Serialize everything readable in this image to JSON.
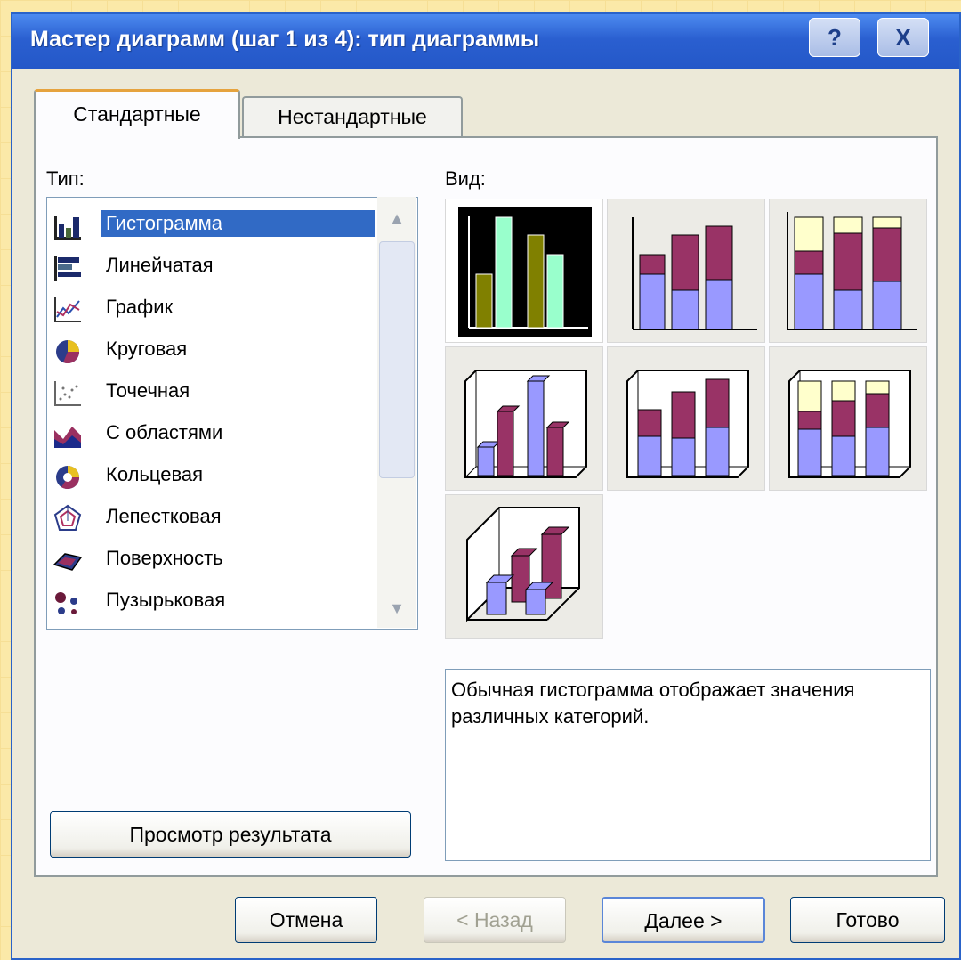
{
  "window": {
    "title": "Мастер диаграмм (шаг 1 из 4): тип диаграммы",
    "help_label": "?",
    "close_label": "X"
  },
  "tabs": [
    {
      "label": "Стандартные",
      "active": true
    },
    {
      "label": "Нестандартные",
      "active": false
    }
  ],
  "type_label": "Тип:",
  "view_label": "Вид:",
  "chart_types": [
    {
      "label": "Гистограмма",
      "icon": "column-chart-icon",
      "selected": true
    },
    {
      "label": "Линейчатая",
      "icon": "bar-chart-icon"
    },
    {
      "label": "График",
      "icon": "line-chart-icon"
    },
    {
      "label": "Круговая",
      "icon": "pie-chart-icon"
    },
    {
      "label": "Точечная",
      "icon": "scatter-chart-icon"
    },
    {
      "label": "С областями",
      "icon": "area-chart-icon"
    },
    {
      "label": "Кольцевая",
      "icon": "doughnut-chart-icon"
    },
    {
      "label": "Лепестковая",
      "icon": "radar-chart-icon"
    },
    {
      "label": "Поверхность",
      "icon": "surface-chart-icon"
    },
    {
      "label": "Пузырьковая",
      "icon": "bubble-chart-icon"
    }
  ],
  "subtypes": [
    {
      "name": "clustered-column",
      "selected": true
    },
    {
      "name": "stacked-column"
    },
    {
      "name": "100-stacked-column"
    },
    {
      "name": "3d-clustered-column"
    },
    {
      "name": "3d-stacked-column"
    },
    {
      "name": "3d-100-stacked-column"
    },
    {
      "name": "3d-column"
    }
  ],
  "description": "Обычная гистограмма отображает значения различных категорий.",
  "buttons": {
    "preview": "Просмотр результата",
    "cancel": "Отмена",
    "back": "< Назад",
    "next": "Далее >",
    "finish": "Готово"
  },
  "colors": {
    "titlebar": "#2458c8",
    "selection": "#316ac5",
    "series_blue": "#9999ff",
    "series_purple": "#993366",
    "series_yellow": "#ffffcc",
    "series_olive": "#808000",
    "series_green": "#99ffcc"
  }
}
